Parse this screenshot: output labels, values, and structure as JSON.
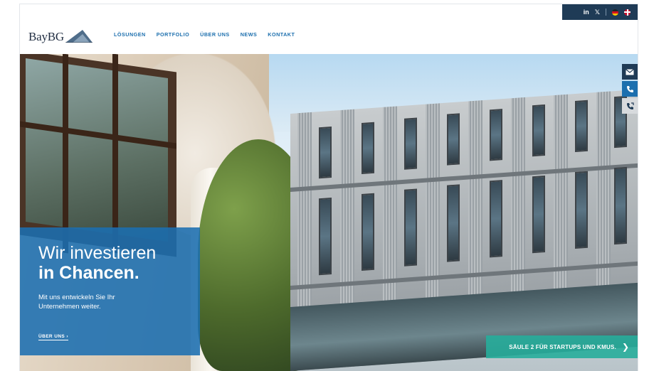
{
  "brand": {
    "logo_text": "BayBG"
  },
  "nav": {
    "items": [
      "LÖSUNGEN",
      "PORTFOLIO",
      "ÜBER UNS",
      "NEWS",
      "KONTAKT"
    ]
  },
  "topbar": {
    "linkedin": "in",
    "xing": "𝕏"
  },
  "hero": {
    "headline_line1": "Wir investieren",
    "headline_line2": "in Chancen.",
    "subline": "Mit uns entwickeln Sie Ihr Unternehmen weiter.",
    "link_label": "ÜBER UNS ›",
    "cta_label": "SÄULE 2 FÜR STARTUPS UND KMUS.",
    "cta_chevron": "❯"
  },
  "colors": {
    "brand_blue": "#1c6fae",
    "navy": "#1f3b56",
    "cta_teal": "#27ad9b"
  },
  "side_buttons": [
    "mail-icon",
    "phone-icon",
    "callback-icon"
  ]
}
